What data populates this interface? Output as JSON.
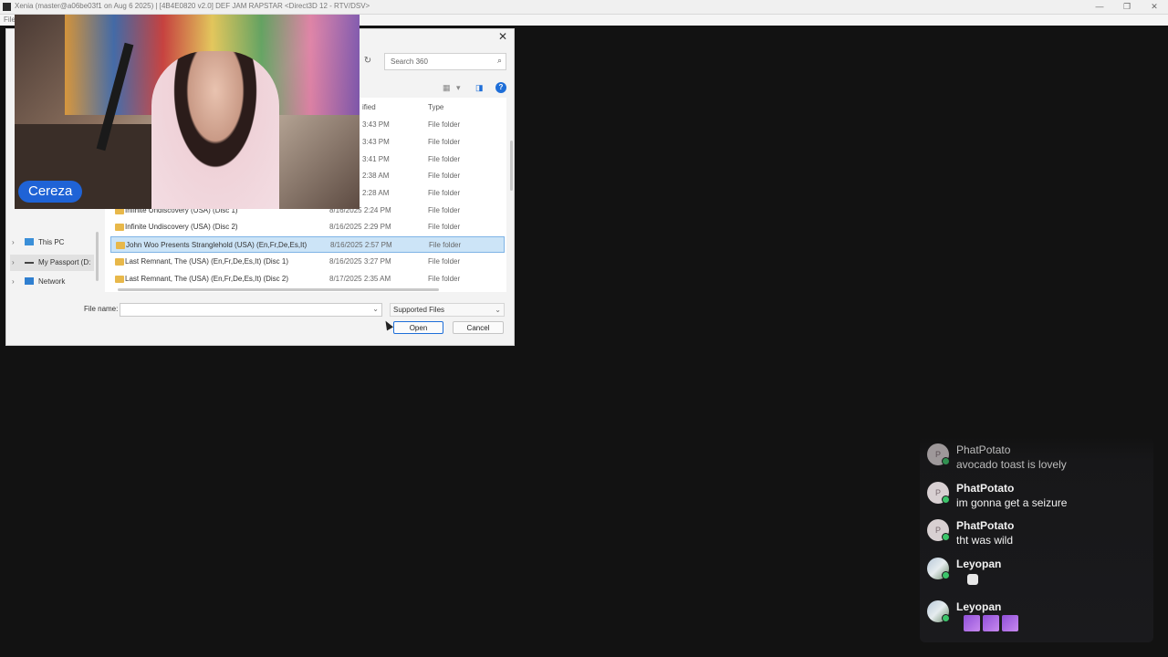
{
  "app": {
    "title": "Xenia (master@a06be03f1 on Aug  6 2025) | [4B4E0820 v2.0] DEF JAM RAPSTAR <Direct3D 12 - RTV/DSV>",
    "menu_first": "File",
    "window_controls": [
      "—",
      "❐",
      "✕"
    ]
  },
  "dialog": {
    "close_glyph": "✕",
    "refresh_glyph": "↻",
    "search_placeholder": "Search 360",
    "search_icon_glyph": "⌕",
    "view_glyph": "▦",
    "view_dropdown_glyph": "▾",
    "pane_glyph": "◨",
    "help_glyph": "?",
    "columns": {
      "date_modified": "ified",
      "type": "Type"
    },
    "rows": [
      {
        "name": "",
        "date": "8/16/2025 3:43 PM",
        "date_shown": "3:43 PM",
        "type": "File folder"
      },
      {
        "name": "",
        "date_shown": "3:43 PM",
        "type": "File folder"
      },
      {
        "name": "",
        "date_shown": "3:41 PM",
        "type": "File folder"
      },
      {
        "name": "",
        "date_shown": "2:38 AM",
        "type": "File folder"
      },
      {
        "name": "",
        "date_shown": "2:28 AM",
        "type": "File folder"
      },
      {
        "name": "Infinite Undiscovery (USA) (Disc 1)",
        "date_shown": "8/16/2025 2:24 PM",
        "type": "File folder"
      },
      {
        "name": "Infinite Undiscovery (USA) (Disc 2)",
        "date_shown": "8/16/2025 2:29 PM",
        "type": "File folder"
      },
      {
        "name": "John Woo Presents Stranglehold (USA) (En,Fr,De,Es,It)",
        "date_shown": "8/16/2025 2:57 PM",
        "type": "File folder",
        "selected": true
      },
      {
        "name": "Last Remnant, The (USA) (En,Fr,De,Es,It) (Disc 1)",
        "date_shown": "8/16/2025 3:27 PM",
        "type": "File folder"
      },
      {
        "name": "Last Remnant, The (USA) (En,Fr,De,Es,It) (Disc 2)",
        "date_shown": "8/17/2025 2:35 AM",
        "type": "File folder"
      }
    ],
    "nav": [
      {
        "label": "This PC",
        "chevron": "›"
      },
      {
        "label": "My Passport (D:",
        "chevron": "›",
        "active": true
      },
      {
        "label": "Network",
        "chevron": "›"
      }
    ],
    "file_name_label": "File name:",
    "file_name_value": "",
    "file_name_dropdown": "⌄",
    "filter_value": "Supported Files",
    "filter_dropdown": "⌄",
    "open_label": "Open",
    "cancel_label": "Cancel"
  },
  "webcam": {
    "name": "Cereza"
  },
  "chat": {
    "messages": [
      {
        "user": "PhatPotato",
        "initial": "P",
        "text": "avocado toast is lovely",
        "faded": true
      },
      {
        "user": "PhatPotato",
        "initial": "P",
        "text": "im gonna get a seizure"
      },
      {
        "user": "PhatPotato",
        "initial": "P",
        "text": "tht was wild"
      },
      {
        "user": "Leyopan",
        "initial": "L",
        "text": "",
        "emotes": 1
      },
      {
        "user": "Leyopan",
        "initial": "L",
        "text": "",
        "emotes": 3
      }
    ]
  }
}
